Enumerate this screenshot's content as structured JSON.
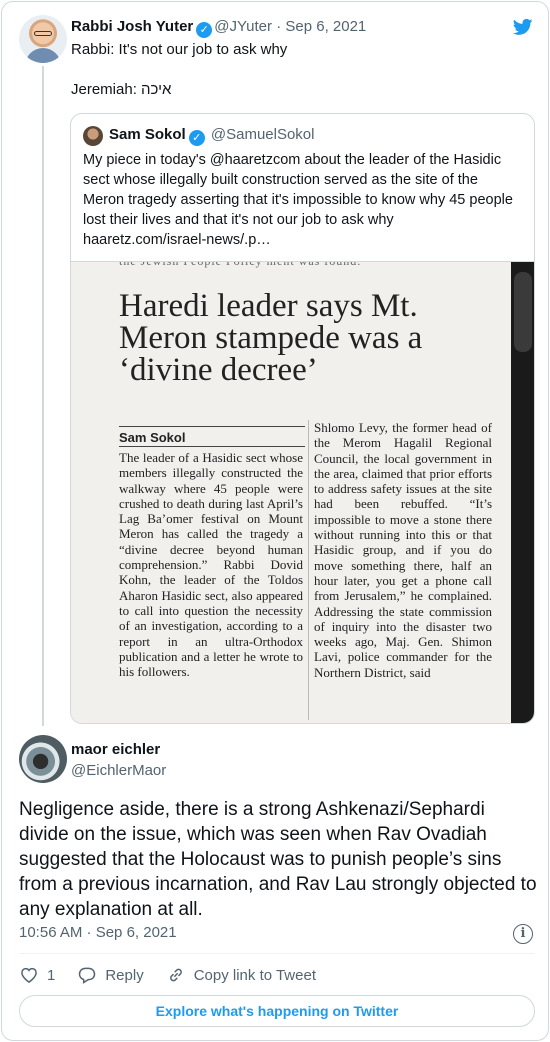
{
  "main_tweet": {
    "name": "Rabbi Josh Yuter",
    "handle": "@JYuter",
    "date": "Sep 6, 2021",
    "line1": "Rabbi: It's not our job to ask why",
    "line2": "Jeremiah: איכה"
  },
  "quoted_tweet": {
    "name": "Sam Sokol",
    "handle": "@SamuelSokol",
    "text": "My piece in today's @haaretzcom about the leader of the Hasidic sect whose illegally built construction served as the site of the Meron tragedy asserting that it's impossible to know why 45 people lost their lives and that it's not our job to ask why",
    "link": "haaretz.com/israel-news/.p…",
    "image": {
      "top_strip": "the Jewish People Policy    ment was found.",
      "headline": "Haredi leader says Mt. Meron stampede was a ‘divine decree’",
      "byline": "Sam Sokol",
      "col1": "The leader of a Hasidic sect whose members illegally constructed the walkway where 45 people were crushed to death during last April’s Lag Ba’omer festival on Mount Meron has called the tragedy a “divine decree beyond human comprehension.” Rabbi Dovid Kohn, the leader of the Toldos Aharon Hasidic sect, also appeared to call into question the necessity of an investigation, according to a report in an ultra-Orthodox publication and a letter he wrote to his followers.",
      "col2": "Shlomo Levy, the former head of the Merom Hagalil Regional Council, the local government in the area, claimed that prior efforts to address safety issues at the site had been rebuffed. “It’s impossible to move a stone there without running into this or that Hasidic group, and if you do move something there, half an hour later, you get a phone call from Jerusalem,” he complained. Addressing the state commission of inquiry into the disaster two weeks ago, Maj. Gen. Shimon Lavi, police commander for the Northern District, said"
    }
  },
  "reply_tweet": {
    "name": "maor eichler",
    "handle": "@EichlerMaor",
    "body": "Negligence aside, there is a strong Ashkenazi/Sephardi divide on the issue, which was seen when Rav Ovadiah suggested that the Holocaust was to punish people’s sins from a previous incarnation, and Rav Lau strongly objected to any explanation at all.",
    "time": "10:56 AM · Sep 6, 2021"
  },
  "actions": {
    "like_count": "1",
    "reply_label": "Reply",
    "copy_label": "Copy link to Tweet"
  },
  "explore_label": "Explore what's happening on Twitter",
  "icons": [
    "twitter-bird-icon",
    "verified-badge-icon",
    "info-icon",
    "heart-icon",
    "reply-icon",
    "link-icon"
  ],
  "colors": {
    "accent": "#1d9bf0",
    "secondary_text": "#536471",
    "border": "#cfd9de"
  }
}
